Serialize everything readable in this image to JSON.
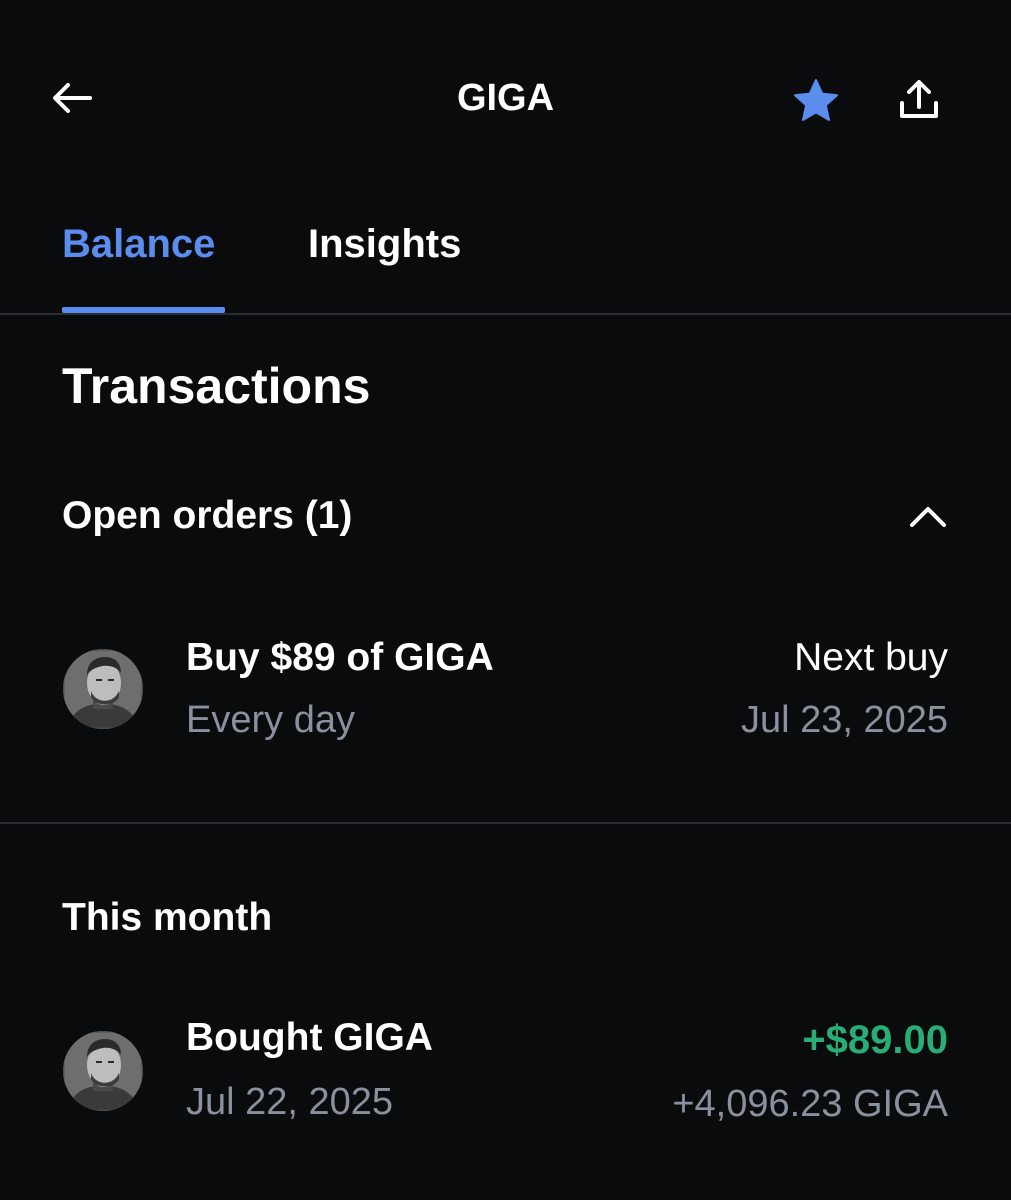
{
  "header": {
    "title": "GIGA",
    "icons": {
      "back": "arrow-left-icon",
      "favorite": "star-icon",
      "share": "share-icon"
    },
    "star_color": "#5b8def"
  },
  "tabs": [
    {
      "label": "Balance",
      "active": true
    },
    {
      "label": "Insights",
      "active": false
    }
  ],
  "accent_color": "#5b8def",
  "transactions": {
    "title": "Transactions",
    "open_orders": {
      "label": "Open orders (1)",
      "expanded": true,
      "items": [
        {
          "title": "Buy $89 of GIGA",
          "subtitle": "Every day",
          "right_label": "Next buy",
          "right_value": "Jul 23, 2025"
        }
      ]
    },
    "this_month": {
      "label": "This month",
      "items": [
        {
          "title": "Bought GIGA",
          "subtitle": "Jul 22, 2025",
          "amount": "+$89.00",
          "amount_color": "#27ad75",
          "quantity": "+4,096.23 GIGA"
        }
      ]
    }
  }
}
